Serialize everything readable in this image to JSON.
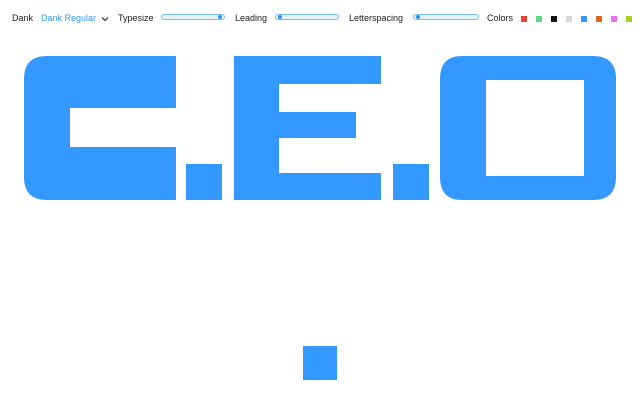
{
  "toolbar": {
    "font_family": "Dank",
    "font_style": "Dank Regular",
    "typesize_label": "Typesize",
    "leading_label": "Leading",
    "letterspacing_label": "Letterspacing",
    "colors_label": "Colors",
    "typesize_value": 0.97,
    "leading_value": 0.03,
    "letterspacing_value": 0.03,
    "swatches": [
      {
        "name": "red",
        "color": "#e8452c"
      },
      {
        "name": "green",
        "color": "#5cd68a"
      },
      {
        "name": "black",
        "color": "#111111"
      },
      {
        "name": "light-gray",
        "color": "#d6d6d6"
      },
      {
        "name": "blue",
        "color": "#3399ff"
      },
      {
        "name": "orange",
        "color": "#d86a1e"
      },
      {
        "name": "pink",
        "color": "#f06ef0"
      },
      {
        "name": "lime",
        "color": "#a8d020"
      }
    ]
  },
  "canvas": {
    "sample_text": "C.E.O.",
    "text_color": "#3399ff"
  }
}
